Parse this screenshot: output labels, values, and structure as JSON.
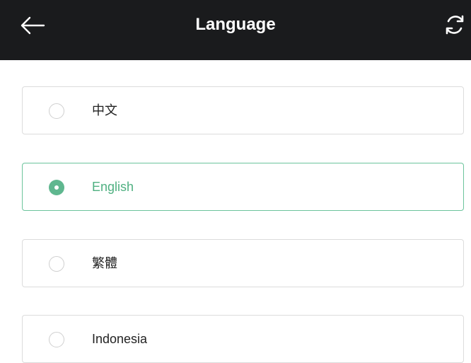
{
  "header": {
    "title": "Language",
    "back_icon": "arrow-left-icon",
    "refresh_icon": "refresh-icon",
    "background": "#1a1b1d"
  },
  "languages": {
    "accent_color": "#5fb78f",
    "items": [
      {
        "label": "中文",
        "selected": false
      },
      {
        "label": "English",
        "selected": true
      },
      {
        "label": "繁體",
        "selected": false
      },
      {
        "label": "Indonesia",
        "selected": false
      }
    ]
  }
}
